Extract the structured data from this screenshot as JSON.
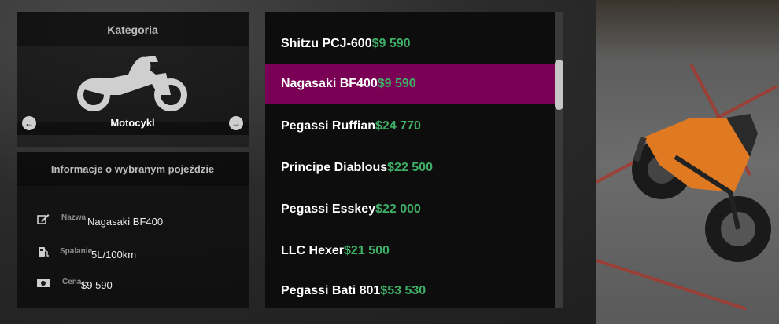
{
  "category_panel": {
    "title": "Kategoria",
    "category_name": "Motocykl",
    "icon": "motorcycle-icon"
  },
  "info_panel": {
    "title": "Informacje o wybranym pojeździe",
    "rows": [
      {
        "label": "Nazwa",
        "value": "Nagasaki BF400",
        "icon": "edit-icon"
      },
      {
        "label": "Spalanie",
        "value": "5L/100km",
        "icon": "fuel-icon"
      },
      {
        "label": "Cena",
        "value": "$9 590",
        "icon": "money-icon"
      }
    ]
  },
  "vehicle_list": {
    "selected_index": 1,
    "items": [
      {
        "name": "Shitzu PCJ-600",
        "price": "$9 590"
      },
      {
        "name": "Nagasaki BF400",
        "price": "$9 590"
      },
      {
        "name": "Pegassi Ruffian",
        "price": "$24 770"
      },
      {
        "name": "Principe Diablous",
        "price": "$22 500"
      },
      {
        "name": "Pegassi Esskey",
        "price": "$22 000"
      },
      {
        "name": "LLC Hexer",
        "price": "$21 500"
      },
      {
        "name": "Pegassi Bati 801",
        "price": "$53 530"
      }
    ]
  },
  "colors": {
    "accent": "#7a0055",
    "price": "#3fae66"
  }
}
